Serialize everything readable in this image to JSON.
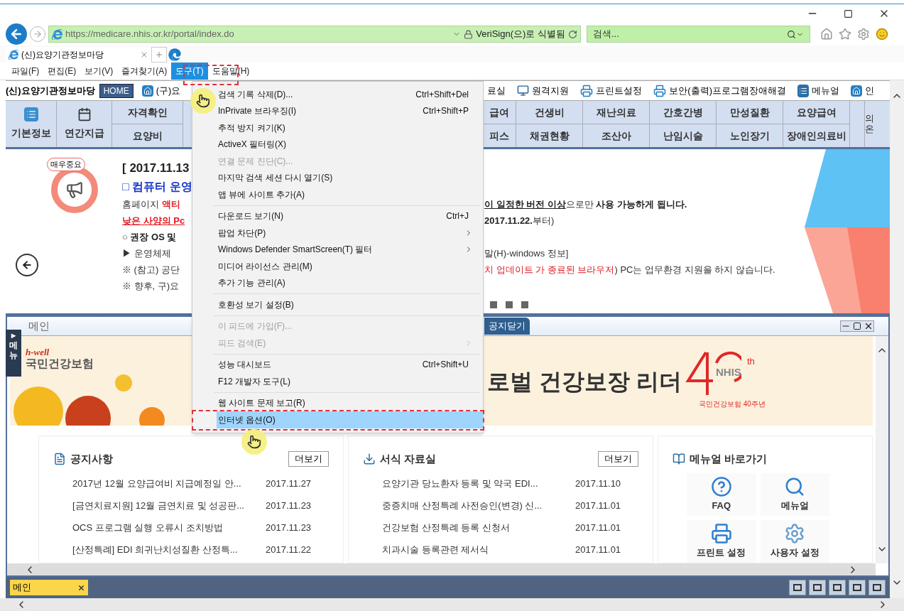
{
  "browser": {
    "url": "https://medicare.nhis.or.kr/portal/index.do",
    "identity": "VeriSign(으)로 식별됨",
    "search": {
      "placeholder": "검색..."
    }
  },
  "tabs": [
    {
      "label": "(신)요양기관정보마당",
      "selected": true
    }
  ],
  "menu_bar": [
    {
      "label": "파일(F)",
      "selected": false
    },
    {
      "label": "편집(E)",
      "selected": false
    },
    {
      "label": "보기(V)",
      "selected": false
    },
    {
      "label": "즐겨찾기(A)",
      "selected": false
    },
    {
      "label": "도구(T)",
      "selected": true
    },
    {
      "label": "도움말(H)",
      "selected": false
    }
  ],
  "portal_toolbar": {
    "title": "(신)요양기관정보마당",
    "home_button": "HOME",
    "links_left": [
      {
        "label": "(구)요",
        "kind": "home"
      }
    ],
    "links_right": [
      {
        "label": "료실",
        "kind": "text"
      },
      {
        "label": "원격지원",
        "kind": "monitor"
      },
      {
        "label": "프린트설정",
        "kind": "printer"
      },
      {
        "label": "보안(출력)프로그램장애해결",
        "kind": "printer"
      },
      {
        "label": "메뉴얼",
        "kind": "manual"
      },
      {
        "label": "인",
        "kind": "home"
      }
    ]
  },
  "nav": {
    "left": [
      {
        "kind": "icon",
        "label": "기본정보"
      },
      {
        "kind": "calendar",
        "label": "연간지급"
      },
      {
        "kind": "pair",
        "top": "자격확인",
        "bottom": "요양비"
      }
    ],
    "right": [
      {
        "top": "급여",
        "bottom": "피스"
      },
      {
        "top": "건생비",
        "bottom": "채권현황"
      },
      {
        "top": "재난의료",
        "bottom": "조산아"
      },
      {
        "top": "간호간병",
        "bottom": "난임시술"
      },
      {
        "top": "만성질환",
        "bottom": "노인장기"
      },
      {
        "top": "요양급여",
        "bottom": "장애인의료비"
      }
    ],
    "edge": "의온"
  },
  "notice": {
    "badge": "매우중요",
    "lines": [
      {
        "left": [
          {
            "text": "[ 2017.11.13",
            "kind": "title"
          }
        ]
      },
      {
        "left": [
          {
            "text": "□ 컴퓨터 운영",
            "kind": "subtitle"
          }
        ]
      },
      {
        "left": [
          {
            "text": "홈페이지 ",
            "kind": "plain"
          },
          {
            "text": "액티",
            "kind": "red"
          }
        ],
        "right": [
          {
            "text": "이 일정한 버전 이상",
            "kind": "underline"
          },
          {
            "text": "으로만 ",
            "kind": "plain"
          },
          {
            "text": "사용 가능하게 됩니다.",
            "kind": "bold"
          }
        ]
      },
      {
        "left": [
          {
            "text": "낮은 사양의 Pc",
            "kind": "red_underline"
          }
        ],
        "right": [
          {
            "text": "2017.11.22.",
            "kind": "bold"
          },
          {
            "text": "부터)",
            "kind": "plain"
          }
        ]
      },
      {
        "left": [
          {
            "text": "○ 권장 OS 및",
            "kind": "bold"
          }
        ]
      },
      {
        "left": [
          {
            "text": "▶ 운영체제",
            "kind": "plain"
          }
        ],
        "right": [
          {
            "text": "말(H)-windows 정보]",
            "kind": "plain"
          }
        ]
      },
      {
        "left": [
          {
            "text": "※ (참고) 공단",
            "kind": "plain"
          }
        ],
        "right": [
          {
            "text": "치 업데이트 가 종료된 브라우저",
            "kind": "red_plain"
          },
          {
            "text": ") PC는 업무환경 지원을 하지 않습니다.",
            "kind": "plain"
          }
        ]
      },
      {
        "left": [
          {
            "text": "※ 향후, 구)요",
            "kind": "plain"
          }
        ]
      }
    ]
  },
  "tools_menu": [
    {
      "kind": "item",
      "label": "검색 기록 삭제(D)...",
      "shortcut": "Ctrl+Shift+Del",
      "submenu": false,
      "disabled": false,
      "selected": false
    },
    {
      "kind": "item",
      "label": "InPrivate 브라우징(I)",
      "shortcut": "Ctrl+Shift+P",
      "submenu": false,
      "disabled": false,
      "selected": false
    },
    {
      "kind": "item",
      "label": "추적 방지 켜기(K)",
      "submenu": false,
      "disabled": false,
      "selected": false
    },
    {
      "kind": "item",
      "label": "ActiveX 필터링(X)",
      "submenu": false,
      "disabled": false,
      "selected": false
    },
    {
      "kind": "item",
      "label": "연결 문제 진단(C)...",
      "submenu": false,
      "disabled": true,
      "selected": false
    },
    {
      "kind": "item",
      "label": "마지막 검색 세션 다시 열기(S)",
      "submenu": false,
      "disabled": false,
      "selected": false
    },
    {
      "kind": "item",
      "label": "앱 뷰에 사이트 추가(A)",
      "submenu": false,
      "disabled": false,
      "selected": false
    },
    {
      "kind": "separator"
    },
    {
      "kind": "item",
      "label": "다운로드 보기(N)",
      "shortcut": "Ctrl+J",
      "submenu": false,
      "disabled": false,
      "selected": false
    },
    {
      "kind": "item",
      "label": "팝업 차단(P)",
      "submenu": true,
      "disabled": false,
      "selected": false
    },
    {
      "kind": "item",
      "label": "Windows Defender SmartScreen(T) 필터",
      "submenu": true,
      "disabled": false,
      "selected": false
    },
    {
      "kind": "item",
      "label": "미디어 라이선스 관리(M)",
      "submenu": false,
      "disabled": false,
      "selected": false
    },
    {
      "kind": "item",
      "label": "추가 기능 관리(A)",
      "submenu": false,
      "disabled": false,
      "selected": false
    },
    {
      "kind": "separator"
    },
    {
      "kind": "item",
      "label": "호환성 보기 설정(B)",
      "submenu": false,
      "disabled": false,
      "selected": false
    },
    {
      "kind": "separator"
    },
    {
      "kind": "item",
      "label": "이 피드에 가입(F)...",
      "submenu": false,
      "disabled": true,
      "selected": false
    },
    {
      "kind": "item",
      "label": "피드 검색(E)",
      "submenu": true,
      "disabled": true,
      "selected": false
    },
    {
      "kind": "separator"
    },
    {
      "kind": "item",
      "label": "성능 대시보드",
      "shortcut": "Ctrl+Shift+U",
      "submenu": false,
      "disabled": false,
      "selected": false
    },
    {
      "kind": "item",
      "label": "F12 개발자 도구(L)",
      "submenu": false,
      "disabled": false,
      "selected": false
    },
    {
      "kind": "separator"
    },
    {
      "kind": "item",
      "label": "웹 사이트 문제 보고(R)",
      "submenu": false,
      "disabled": false,
      "selected": false
    },
    {
      "kind": "item",
      "label": "인터넷 옵션(O)",
      "submenu": false,
      "disabled": false,
      "selected": true
    }
  ],
  "main_window": {
    "title": "메인",
    "close_notice_button": "공지닫기",
    "side_tab": {
      "arrow": "▸",
      "label": "메뉴"
    },
    "banner": {
      "brand_tag": "h-well",
      "brand": "국민건강보험",
      "slogan": "로벌 건강보장 리더",
      "logo_mark": "NHIS",
      "logo_suffix": "th",
      "logo_caption": "국민건강보험 40주년"
    },
    "cards": [
      {
        "kind": "list",
        "title": "공지사항",
        "more": "더보기",
        "rows": [
          {
            "title": "2017년 12월 요양급여비 지급예정일 안...",
            "date": "2017.11.27"
          },
          {
            "title": "[금연치료지원] 12월 금연치료 및 성공판...",
            "date": "2017.11.23"
          },
          {
            "title": "OCS 프로그램 실행 오류시 조치방법",
            "date": "2017.11.23"
          },
          {
            "title": "[산정특례] EDI 희귀난치성질환 산정특...",
            "date": "2017.11.22"
          }
        ]
      },
      {
        "kind": "list",
        "title": "서식 자료실",
        "more": "더보기",
        "rows": [
          {
            "title": "요양기관 당뇨환자 등록 및 약국 EDI...",
            "date": "2017.11.10"
          },
          {
            "title": "중증치매 산정특례 사전승인(변경) 신...",
            "date": "2017.11.01"
          },
          {
            "title": "건강보험 산정특례 등록 신청서",
            "date": "2017.11.01"
          },
          {
            "title": "치과시술 등록관련 제서식",
            "date": "2017.11.01"
          }
        ]
      },
      {
        "kind": "tiles",
        "title": "메뉴얼 바로가기",
        "tiles": [
          {
            "label": "FAQ",
            "kind": "faq"
          },
          {
            "label": "메뉴얼",
            "kind": "manual"
          },
          {
            "label": "프린트 설정",
            "kind": "printer"
          },
          {
            "label": "사용자 설정",
            "kind": "gear"
          }
        ]
      }
    ]
  },
  "bottom_tabs": [
    {
      "label": "메인",
      "selected": true
    }
  ]
}
